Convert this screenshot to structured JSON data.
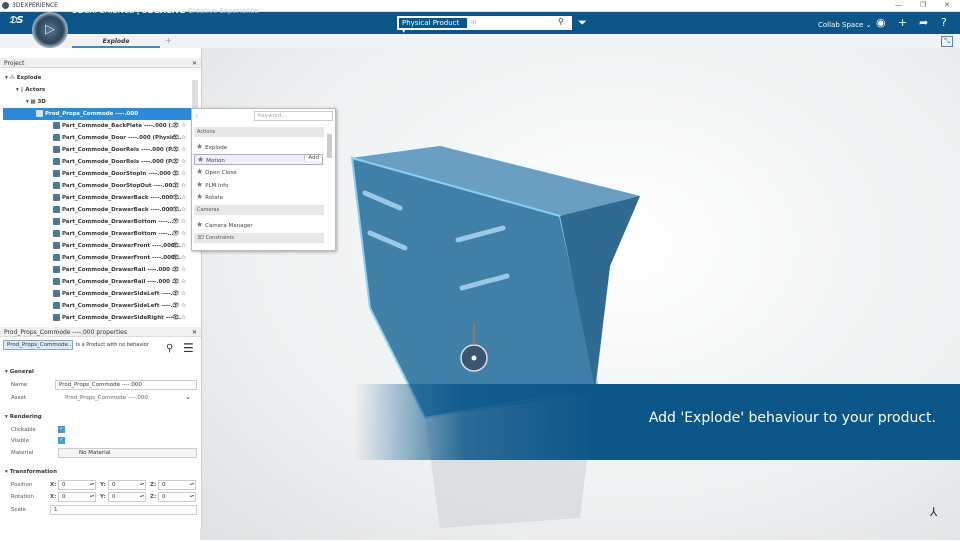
{
  "window": {
    "title": "3DEXPERIENCE",
    "minimize": "—",
    "restore": "❐",
    "close": "✕"
  },
  "header": {
    "brand_bold": "3D",
    "brand_main": "EXPERIENCE | ",
    "brand_app": "3DEXCITE",
    "brand_sub": "Creative Experience",
    "product_type": "Physical Product ▾",
    "search_placeholder": "In",
    "collab_space": "Collab Space ⌄"
  },
  "tabs": {
    "active": "Explode",
    "add": "+"
  },
  "project": {
    "title": "Project",
    "close": "✕",
    "root": "Explode",
    "actors": "Actors",
    "node3d": "3D",
    "selected": "Prod_Props_Commode ----.000",
    "parts": [
      "Part_Commode_BackPlate ----.000 (...",
      "Part_Commode_Door ----.000 (Physic...",
      "Part_Commode_DoorReis ----.000 (P...",
      "Part_Commode_DoorReis ----.000 (P...",
      "Part_Commode_DoorStopIn ----.000 ...",
      "Part_Commode_DoorStopOut ----.00...",
      "Part_Commode_DrawerBack ----.000 ...",
      "Part_Commode_DrawerBack ----.000 ...",
      "Part_Commode_DrawerBottom ----...",
      "Part_Commode_DrawerBottom ----...",
      "Part_Commode_DrawerFront ----.000...",
      "Part_Commode_DrawerFront ----.000...",
      "Part_Commode_DrawerRail ----.000 ...",
      "Part_Commode_DrawerRail ----.000 ...",
      "Part_Commode_DrawerSideLeft ----...",
      "Part_Commode_DrawerSideLeft ----...",
      "Part_Commode_DrawerSideRight ----..."
    ]
  },
  "menu": {
    "keyword_placeholder": "Keyword...",
    "categories": {
      "actions": "Actions",
      "cameras": "Cameras",
      "constraints": "3D Constraints"
    },
    "actions": [
      "Explode",
      "Motion",
      "Open Close",
      "PLM Info",
      "Rotate"
    ],
    "cameras": [
      "Camera Manager"
    ],
    "add": "Add"
  },
  "properties": {
    "title": "Prod_Props_Commode ----.000 properties",
    "chip": "Prod_Props_Commode...",
    "desc": "is a Product with no behavior",
    "general": "General",
    "name_label": "Name",
    "name_value": "Prod_Props_Commode ----.000",
    "asset_label": "Asset",
    "asset_value": "Prod_Props_Commode ----.000",
    "rendering": "Rendering",
    "clickable_label": "Clickable",
    "clickable": true,
    "visible_label": "Visible",
    "visible": true,
    "material_label": "Material",
    "material_value": "No Material",
    "transformation": "Transformation",
    "position_label": "Position",
    "rotation_label": "Rotation",
    "scale_label": "Scale",
    "x": "X:",
    "y": "Y:",
    "z": "Z:",
    "position": [
      "0",
      "0",
      "0"
    ],
    "rotation": [
      "0",
      "0",
      "0"
    ],
    "scale": "1"
  },
  "banner": {
    "text": "Add 'Explode' behaviour to your product."
  },
  "colors": {
    "brand": "#0b5689",
    "selection": "#2d8ad6",
    "model": "#3f7fa8"
  }
}
